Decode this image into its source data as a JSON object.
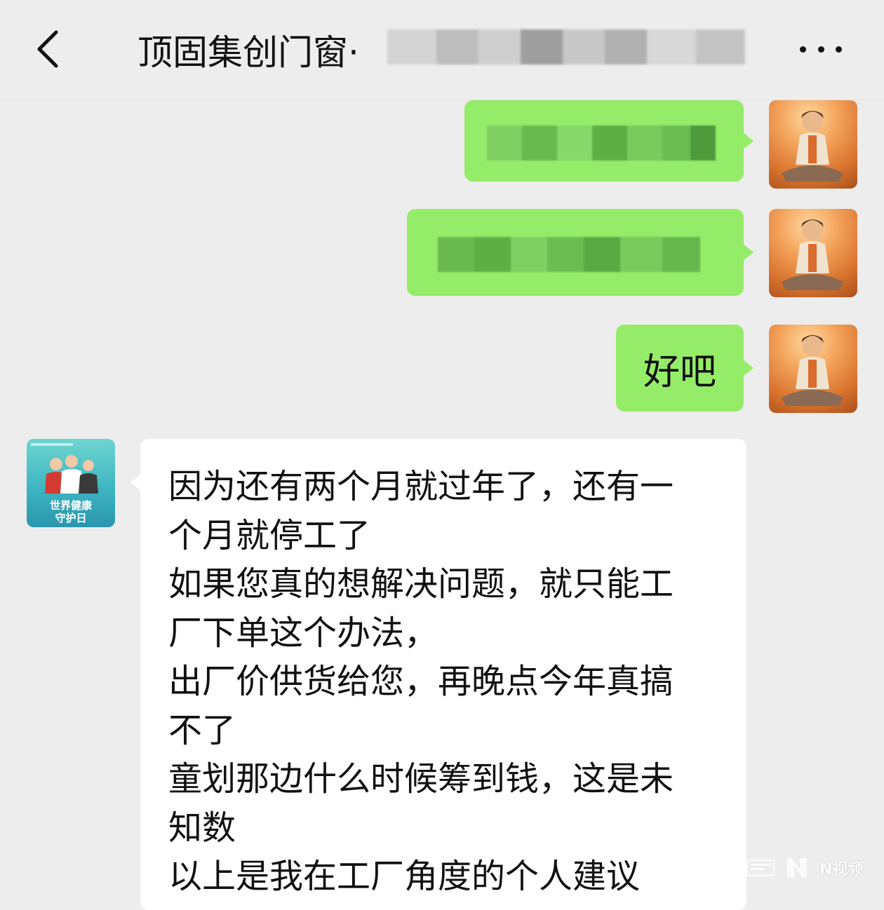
{
  "header": {
    "title": "顶固集创门窗·",
    "back_icon": "chevron-left-icon",
    "more_icon": "more-horizontal-icon"
  },
  "messages": [
    {
      "side": "right",
      "text": "",
      "redacted": true
    },
    {
      "side": "right",
      "text": "",
      "redacted": true
    },
    {
      "side": "right",
      "text": "好吧",
      "redacted": false
    },
    {
      "side": "left",
      "lines": [
        "因为还有两个月就过年了，还有一",
        "个月就停工了",
        "如果您真的想解决问题，就只能工",
        "厂下单这个办法，",
        "出厂价供货给您，再晚点今年真搞",
        "不了",
        "童划那边什么时候筹到钱，这是未",
        "知数",
        "以上是我在工厂角度的个人建议"
      ]
    }
  ],
  "other_avatar": {
    "caption_line1": "世界健康",
    "caption_line2": "守护日"
  },
  "watermark": {
    "brand": "N视频"
  },
  "colors": {
    "background": "#ededed",
    "sent_bubble": "#95ec69",
    "received_bubble": "#ffffff"
  }
}
